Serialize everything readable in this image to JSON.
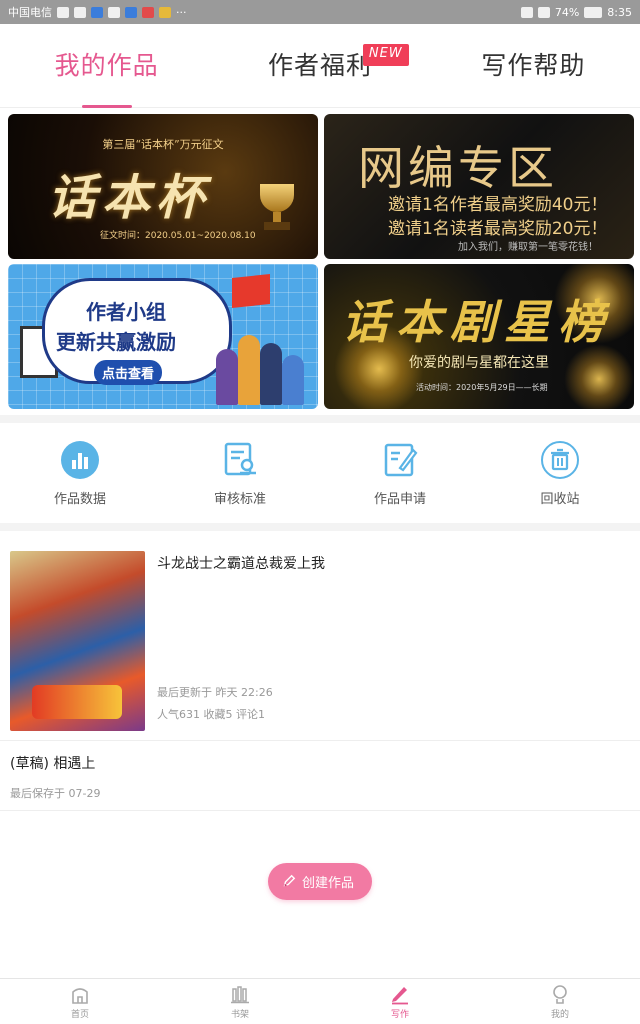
{
  "statusbar": {
    "carrier": "中国电信",
    "battery": "74%",
    "time": "8:35"
  },
  "tabs": [
    {
      "label": "我的作品",
      "active": true
    },
    {
      "label": "作者福利",
      "badge": "NEW"
    },
    {
      "label": "写作帮助"
    }
  ],
  "banners": {
    "b1": {
      "sub": "第三届“话本杯”万元征文",
      "big": "话本杯",
      "date": "征文时间：2020.05.01~2020.08.10"
    },
    "b2": {
      "big": "网编专区",
      "line1": "邀请1名作者最高奖励40元！",
      "line2": "邀请1名读者最高奖励20元！",
      "line3": "加入我们，赚取第一笔零花钱！"
    },
    "b3": {
      "line1": "作者小组",
      "line2": "更新共赢激励",
      "button": "点击查看"
    },
    "b4": {
      "big": "话本剧星榜",
      "sub": "你爱的剧与星都在这里",
      "date": "活动时间：2020年5月29日——长期"
    }
  },
  "tools": [
    {
      "label": "作品数据",
      "icon": "chart-icon"
    },
    {
      "label": "审核标准",
      "icon": "review-icon"
    },
    {
      "label": "作品申请",
      "icon": "apply-icon"
    },
    {
      "label": "回收站",
      "icon": "trash-icon"
    }
  ],
  "work": {
    "title": "斗龙战士之霸道总裁爱上我",
    "updated": "最后更新于 昨天 22:26",
    "stats": "人气631 收藏5 评论1"
  },
  "draft": {
    "title": "(草稿) 相遇上",
    "saved": "最后保存于 07-29"
  },
  "create_label": "创建作品",
  "nav": [
    {
      "label": "首页"
    },
    {
      "label": "书架"
    },
    {
      "label": "写作",
      "active": true
    },
    {
      "label": "我的"
    }
  ],
  "colors": {
    "accent": "#e5588f",
    "button": "#f27aa3",
    "tool_icon": "#5ab4e6"
  }
}
